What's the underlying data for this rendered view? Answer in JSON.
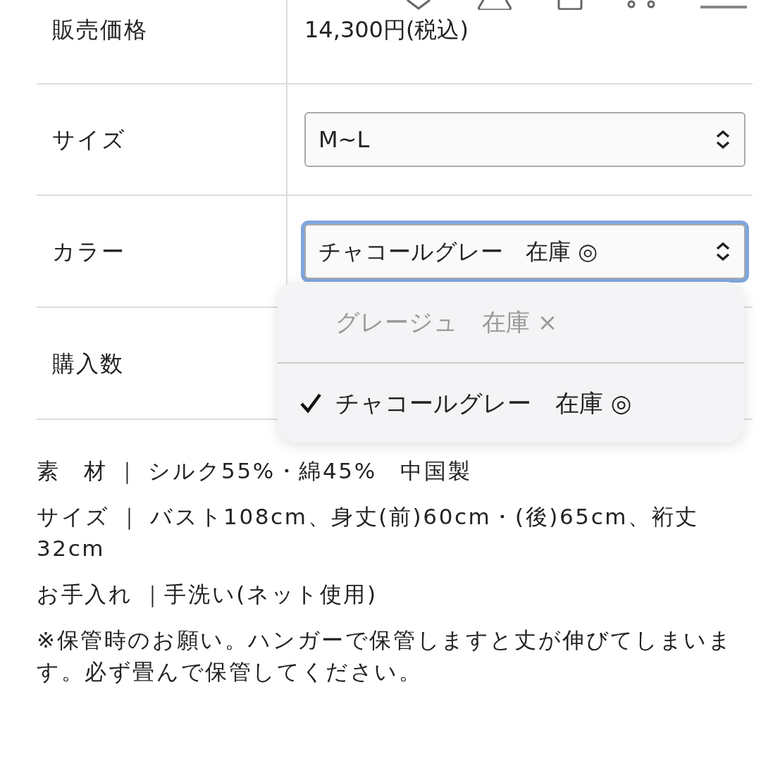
{
  "spec_rows": [
    {
      "label": "販売価格",
      "kind": "text",
      "value": "14,300円(税込)"
    },
    {
      "label": "サイズ",
      "kind": "select",
      "value": "M~L",
      "expanded": false
    },
    {
      "label": "カラー",
      "kind": "select",
      "value": "チャコールグレー　在庫 ◎",
      "expanded": true
    },
    {
      "label": "購入数",
      "kind": "hidden"
    }
  ],
  "color_menu": {
    "options": [
      {
        "label": "グレージュ　在庫 ×",
        "disabled": true,
        "selected": false
      },
      {
        "label": "チャコールグレー　在庫 ◎",
        "disabled": false,
        "selected": true
      }
    ]
  },
  "notes": [
    "素　材 ｜ シルク55%・綿45%　中国製",
    "サイズ ｜ バスト108cm、身丈(前)60cm・(後)65cm、裄丈32cm",
    "お手入れ ｜手洗い(ネット使用)",
    "※保管時のお願い。ハンガーで保管しますと丈が伸びてしまいます。必ず畳んで保管してください。"
  ]
}
